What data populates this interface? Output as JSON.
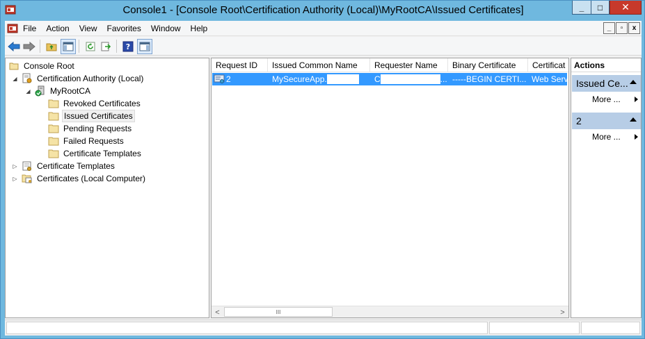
{
  "window": {
    "title": "Console1 - [Console Root\\Certification Authority (Local)\\MyRootCA\\Issued Certificates]",
    "minimize": "_",
    "maximize": "□",
    "close": "✕"
  },
  "menu": {
    "items": [
      "File",
      "Action",
      "View",
      "Favorites",
      "Window",
      "Help"
    ],
    "mdi_min": "_",
    "mdi_restore": "▫",
    "mdi_close": "x"
  },
  "toolbar": {
    "buttons": [
      "back-icon",
      "forward-icon",
      "up-folder-icon",
      "show-hide-tree-icon",
      "refresh-icon",
      "export-list-icon",
      "help-icon",
      "show-hide-action-pane-icon"
    ]
  },
  "tree": {
    "items": [
      {
        "label": "Console Root",
        "icon": "console-root-icon",
        "level": 0,
        "expander": ""
      },
      {
        "label": "Certification Authority (Local)",
        "icon": "certification-authority-icon",
        "level": 1,
        "expander": "◢"
      },
      {
        "label": "MyRootCA",
        "icon": "ca-server-icon",
        "level": 2,
        "expander": "◢"
      },
      {
        "label": "Revoked Certificates",
        "icon": "folder-icon",
        "level": 3,
        "expander": ""
      },
      {
        "label": "Issued Certificates",
        "icon": "folder-icon",
        "level": 3,
        "expander": "",
        "selected": true
      },
      {
        "label": "Pending Requests",
        "icon": "folder-icon",
        "level": 3,
        "expander": ""
      },
      {
        "label": "Failed Requests",
        "icon": "folder-icon",
        "level": 3,
        "expander": ""
      },
      {
        "label": "Certificate Templates",
        "icon": "folder-icon",
        "level": 3,
        "expander": ""
      },
      {
        "label": "Certificate Templates",
        "icon": "certificate-templates-icon",
        "level": 1,
        "expander": "▷"
      },
      {
        "label": "Certificates (Local Computer)",
        "icon": "certificates-icon",
        "level": 1,
        "expander": "▷"
      }
    ]
  },
  "list": {
    "columns": [
      "Request ID",
      "Issued Common Name",
      "Requester Name",
      "Binary Certificate",
      "Certificat"
    ],
    "rows": [
      {
        "request_id": "2",
        "issued_common_name": "MySecureApp.",
        "requester_name": "C",
        "requester_suffix": "...",
        "binary_certificate": "-----BEGIN CERTI...",
        "certificate_template": "Web Serv"
      }
    ],
    "scroll_thumb": "III",
    "scroll_left": "<",
    "scroll_right": ">"
  },
  "actions": {
    "title": "Actions",
    "sections": [
      {
        "label": "Issued Ce...",
        "item": "More ..."
      },
      {
        "label": "2",
        "item": "More ..."
      }
    ]
  },
  "colors": {
    "selection": "#3399ff",
    "action_section": "#b7cde6",
    "frame": "#6fb8df"
  }
}
